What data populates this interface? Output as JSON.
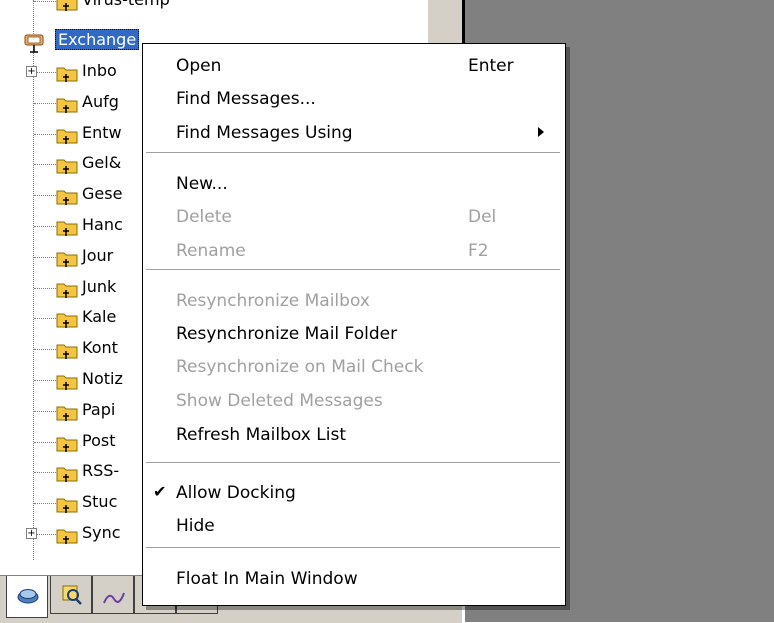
{
  "tree": {
    "top_item": "Virus-temp",
    "root": "Exchange",
    "folders": [
      {
        "label": "Inbo",
        "expandable": true
      },
      {
        "label": "Aufg",
        "expandable": false
      },
      {
        "label": "Entw",
        "expandable": false
      },
      {
        "label": "Gel&",
        "expandable": false
      },
      {
        "label": "Gese",
        "expandable": false
      },
      {
        "label": "Hanc",
        "expandable": false
      },
      {
        "label": "Jour",
        "expandable": false
      },
      {
        "label": "Junk",
        "expandable": false
      },
      {
        "label": "Kale",
        "expandable": false
      },
      {
        "label": "Kont",
        "expandable": false
      },
      {
        "label": "Notiz",
        "expandable": false
      },
      {
        "label": "Papi",
        "expandable": false
      },
      {
        "label": "Post",
        "expandable": false
      },
      {
        "label": "RSS-",
        "expandable": false
      },
      {
        "label": "Stuc",
        "expandable": false
      },
      {
        "label": "Sync",
        "expandable": true
      }
    ]
  },
  "menu": {
    "items": [
      {
        "label": "Open",
        "shortcut": "Enter",
        "enabled": true
      },
      {
        "label": "Find Messages...",
        "shortcut": "",
        "enabled": true
      },
      {
        "label": "Find Messages Using",
        "shortcut": "",
        "enabled": true,
        "submenu": true
      },
      {
        "label": "New...",
        "shortcut": "",
        "enabled": true
      },
      {
        "label": "Delete",
        "shortcut": "Del",
        "enabled": false
      },
      {
        "label": "Rename",
        "shortcut": "F2",
        "enabled": false
      },
      {
        "label": "Resynchronize Mailbox",
        "shortcut": "",
        "enabled": false
      },
      {
        "label": "Resynchronize Mail Folder",
        "shortcut": "",
        "enabled": true
      },
      {
        "label": "Resynchronize on Mail Check",
        "shortcut": "",
        "enabled": false
      },
      {
        "label": "Show Deleted Messages",
        "shortcut": "",
        "enabled": false
      },
      {
        "label": "Refresh Mailbox List",
        "shortcut": "",
        "enabled": true
      },
      {
        "label": "Allow Docking",
        "shortcut": "",
        "enabled": true,
        "checked": true
      },
      {
        "label": "Hide",
        "shortcut": "",
        "enabled": true
      },
      {
        "label": "Float In Main Window",
        "shortcut": "",
        "enabled": true
      }
    ],
    "check_mark": "✔"
  },
  "icons": {
    "folder": "folder-icon",
    "mailbox": "mailbox-icon",
    "tabs": [
      "mail-folders-tab-icon",
      "search-tab-icon",
      "contacts-tab-icon",
      "notes-tab-icon",
      "tasks-tab-icon"
    ]
  },
  "colors": {
    "selection": "#316ac5",
    "disabled_text": "#a0a0a0",
    "folder": "#f5c542",
    "background_gray": "#808080"
  }
}
